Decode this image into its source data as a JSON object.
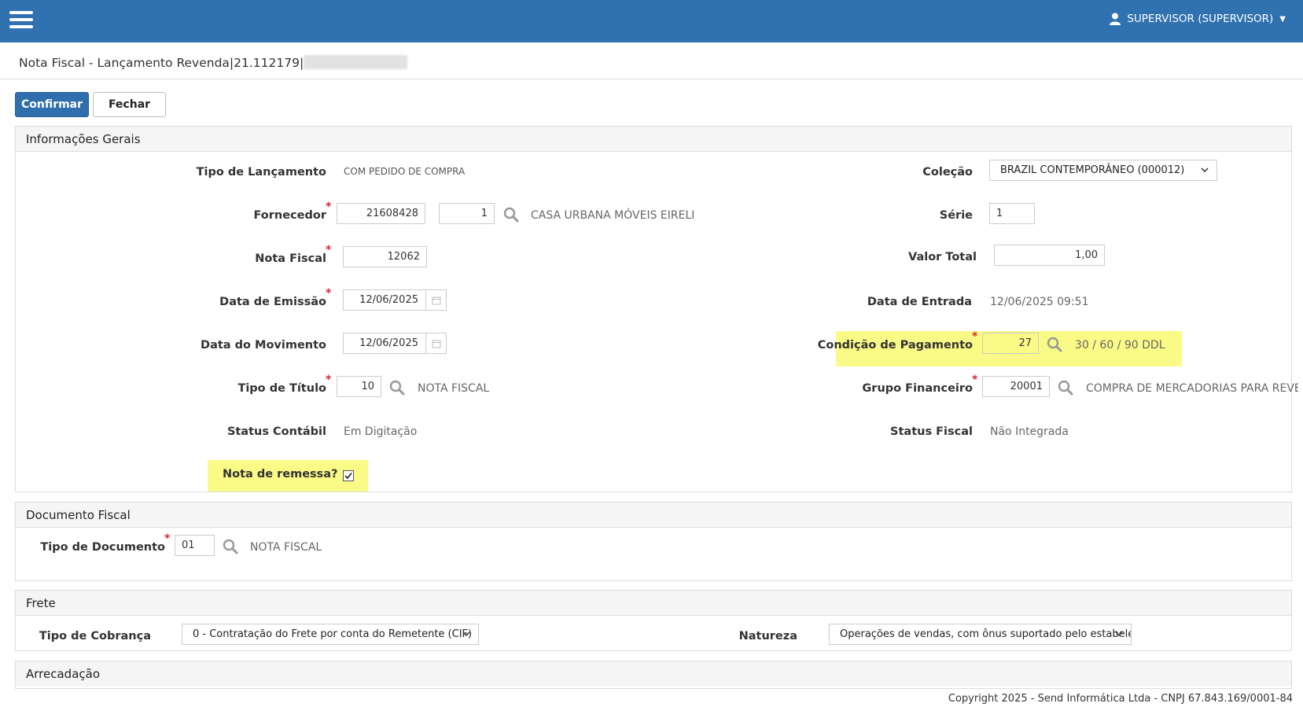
{
  "topbar": {
    "user_label": "SUPERVISOR (SUPERVISOR)",
    "color": "#3071b0"
  },
  "page": {
    "title": "Nota Fiscal - Lançamento Revenda|21.112179|"
  },
  "actions": {
    "confirm_label": "Confirmar",
    "close_label": "Fechar"
  },
  "general": {
    "title": "Informações Gerais",
    "tipo_lancamento_label": "Tipo de Lançamento",
    "tipo_lancamento_value": "COM PEDIDO DE COMPRA",
    "fornecedor_label": "Fornecedor",
    "fornecedor_code": "21608428",
    "fornecedor_seq": "1",
    "fornecedor_name": "CASA URBANA MÓVEIS EIRELI",
    "nota_fiscal_label": "Nota Fiscal",
    "nota_fiscal_value": "12062",
    "data_emissao_label": "Data de Emissão",
    "data_emissao_value": "12/06/2025",
    "data_movimento_label": "Data do Movimento",
    "data_movimento_value": "12/06/2025",
    "tipo_titulo_label": "Tipo de Título",
    "tipo_titulo_code": "10",
    "tipo_titulo_desc": "NOTA FISCAL",
    "status_contabil_label": "Status Contábil",
    "status_contabil_value": "Em Digitação",
    "nota_remessa_label": "Nota de remessa?",
    "colecao_label": "Coleção",
    "colecao_value": "BRAZIL CONTEMPORÂNEO (000012)",
    "serie_label": "Série",
    "serie_value": "1",
    "valor_total_label": "Valor Total",
    "valor_total_value": "1,00",
    "data_entrada_label": "Data de Entrada",
    "data_entrada_value": "12/06/2025 09:51",
    "condicao_label": "Condição de Pagamento",
    "condicao_code": "27",
    "condicao_desc": "30 / 60 / 90 DDL",
    "grupo_label": "Grupo Financeiro",
    "grupo_code": "20001",
    "grupo_desc": "COMPRA DE MERCADORIAS PARA REVENDA",
    "status_fiscal_label": "Status Fiscal",
    "status_fiscal_value": "Não Integrada"
  },
  "documento": {
    "title": "Documento Fiscal",
    "tipo_label": "Tipo de Documento",
    "tipo_code": "01",
    "tipo_desc": "NOTA FISCAL"
  },
  "frete": {
    "title": "Frete",
    "cobranca_label": "Tipo de Cobrança",
    "cobranca_value": "0 - Contratação do Frete por conta do Remetente (CIF)",
    "natureza_label": "Natureza",
    "natureza_value": "Operações de vendas, com ônus suportado pelo estabeleci"
  },
  "arrecadacao": {
    "title": "Arrecadação"
  },
  "footer": {
    "copyright": "Copyright 2025 - Send Informática Ltda - CNPJ 67.843.169/0001-84"
  },
  "icons": {
    "menu": "hamburger-icon",
    "user": "user-icon",
    "search": "search-icon",
    "calendar": "calendar-icon",
    "chevron": "chevron-down-icon",
    "check": "check-icon"
  },
  "colors": {
    "primary": "#2f6fad",
    "highlight": "#fafa86",
    "required": "#d9263a"
  }
}
